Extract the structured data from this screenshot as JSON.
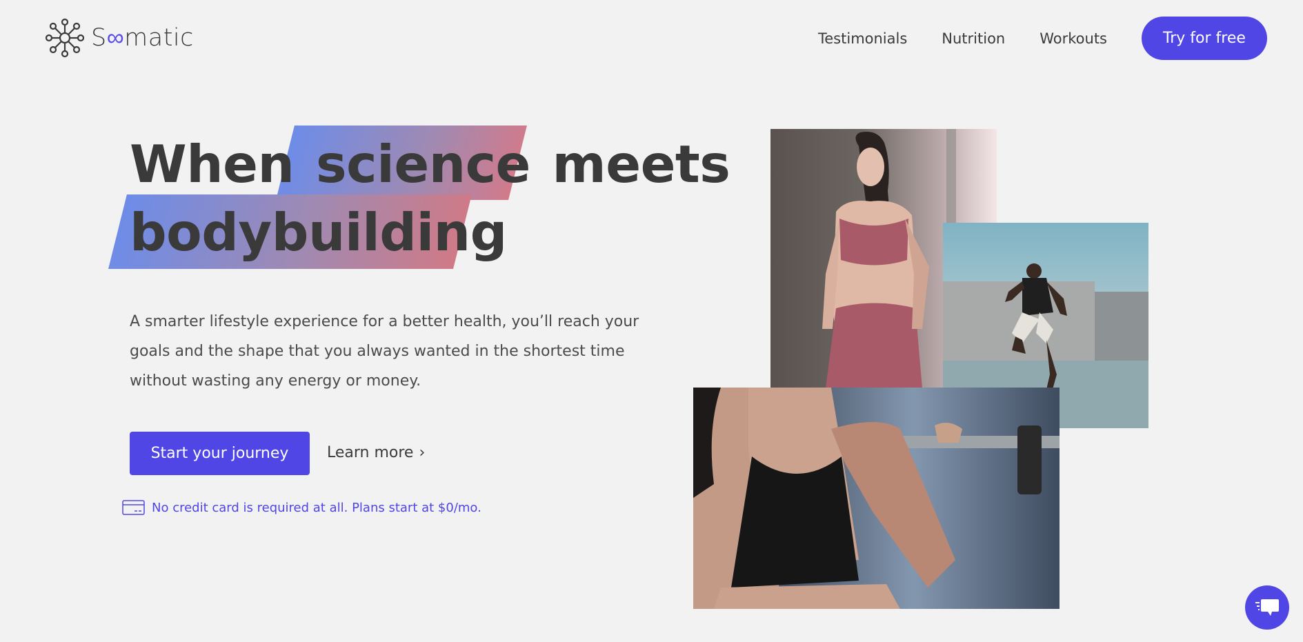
{
  "header": {
    "logo_text_pre": "S",
    "logo_text_infinity": "∞",
    "logo_text_post": "matic",
    "nav": [
      {
        "label": "Testimonials"
      },
      {
        "label": "Nutrition"
      },
      {
        "label": "Workouts"
      }
    ],
    "cta_label": "Try for free"
  },
  "hero": {
    "headline_word1": "When",
    "headline_word2": "science",
    "headline_word3": "meets",
    "headline_line2": "bodybuilding",
    "description": "A smarter lifestyle experience for a better health, you’ll reach your goals and the shape that you always wanted in the shortest time without wasting any energy or money.",
    "primary_button": "Start your journey",
    "secondary_link": "Learn more",
    "secondary_chevron": "›",
    "note": "No credit card is required at all. Plans start at $0/mo."
  },
  "colors": {
    "accent": "#4f46e5",
    "background": "#f2f2f2",
    "text": "#3a3a3a"
  },
  "icons": {
    "logo": "molecule-logo-icon",
    "card": "credit-card-icon",
    "chat": "chat-bubble-icon"
  }
}
